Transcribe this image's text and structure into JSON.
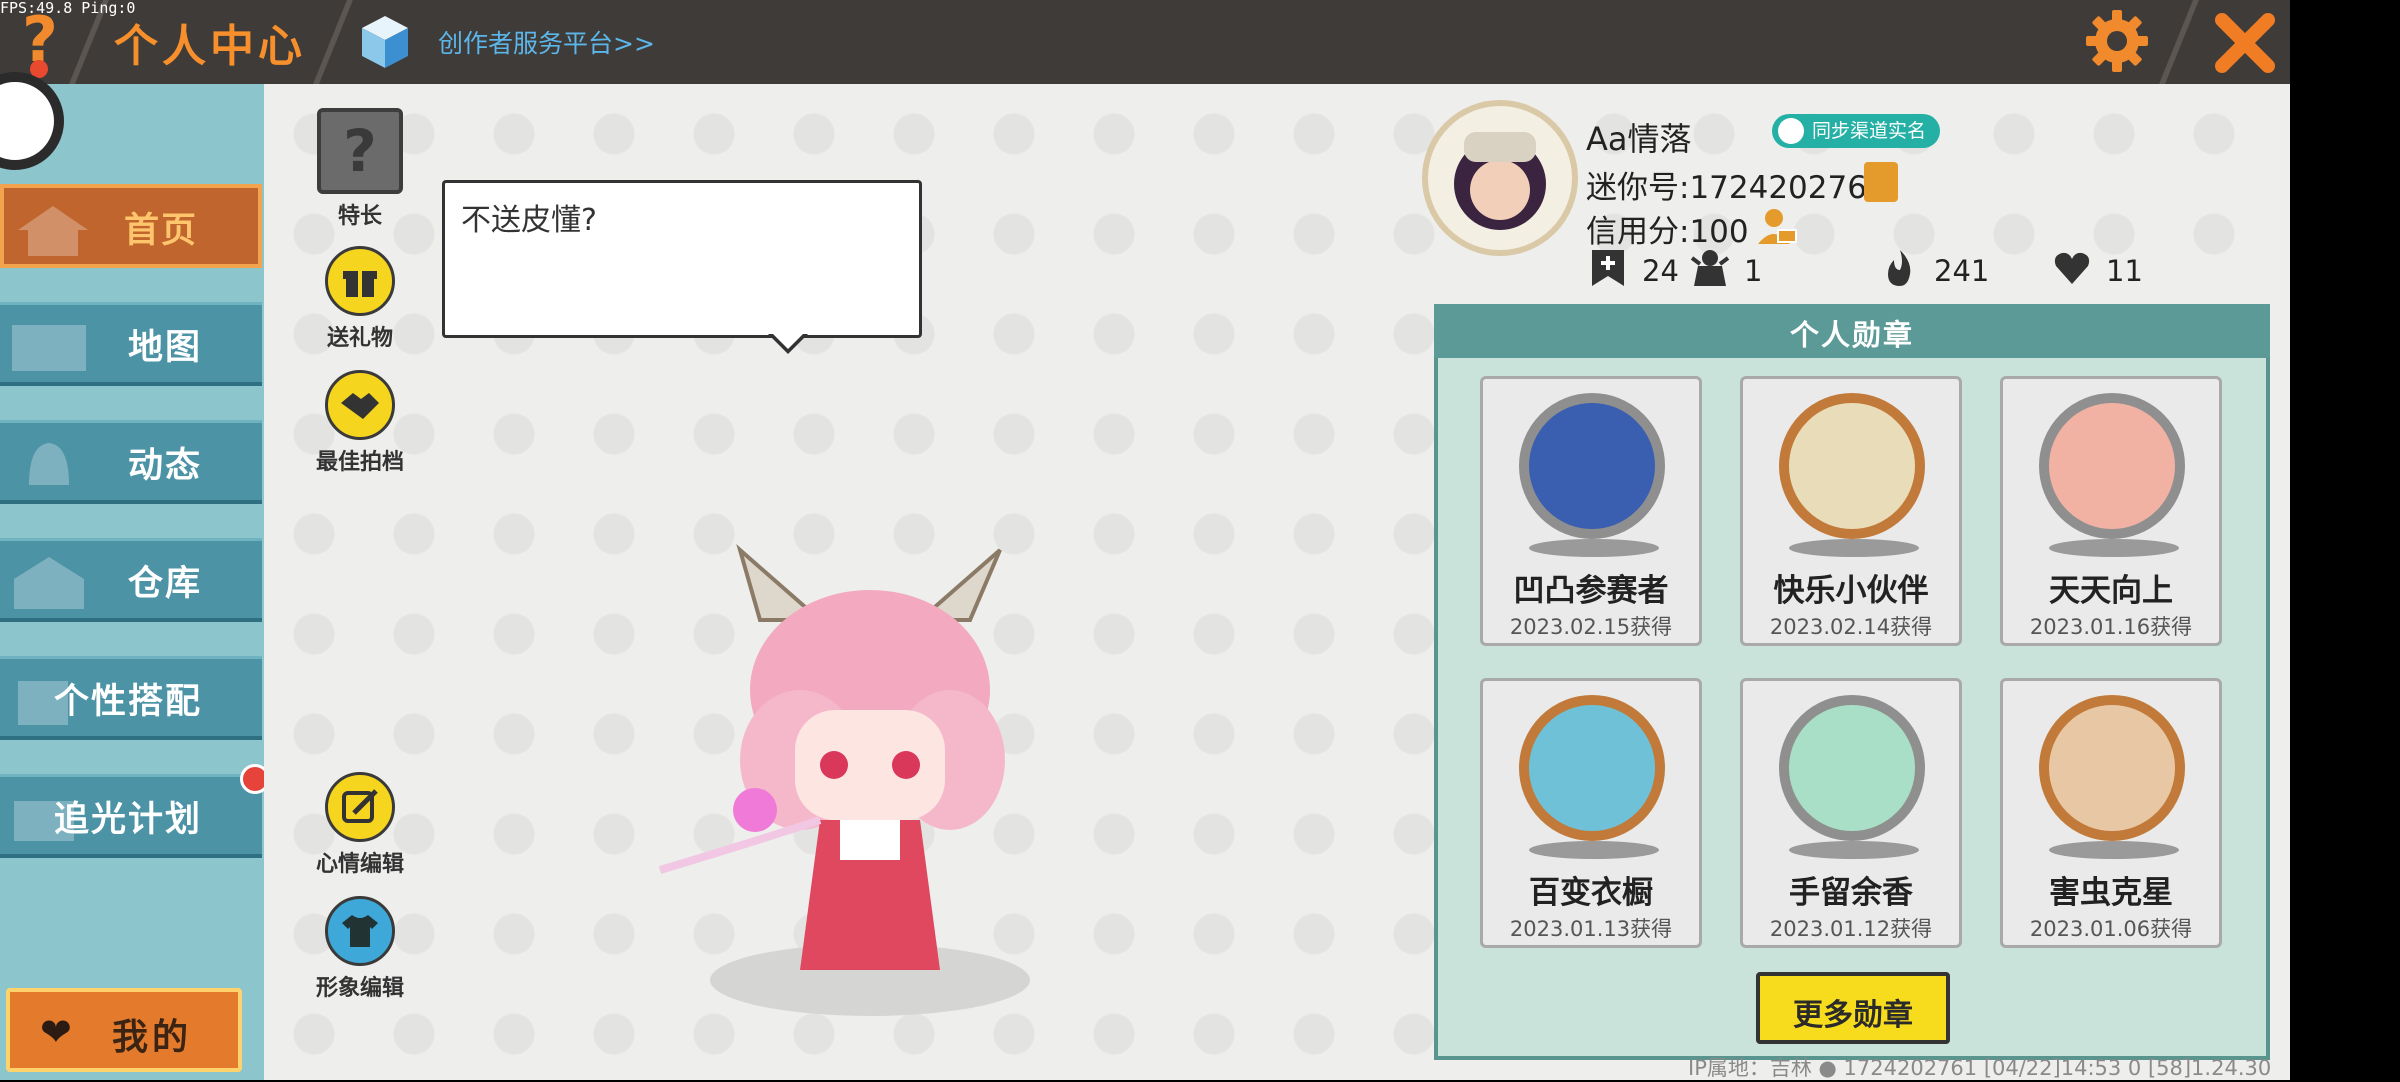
{
  "debug": {
    "fps_text": "FPS:49.8  Ping:0"
  },
  "header": {
    "title": "个人中心",
    "creator_link": "创作者服务平台>>",
    "icons": [
      "help-icon",
      "cube-icon",
      "gear-icon",
      "close-icon"
    ],
    "colors": {
      "bar": "#3f3b38",
      "title": "#f7902c",
      "link": "#5bb6ea",
      "accent": "#f08a2c"
    }
  },
  "sidebar": {
    "items": [
      {
        "label": "首页",
        "active": true
      },
      {
        "label": "地图",
        "active": false
      },
      {
        "label": "动态",
        "active": false
      },
      {
        "label": "仓库",
        "active": false
      },
      {
        "label": "个性搭配",
        "active": false
      },
      {
        "label": "追光计划",
        "active": false,
        "notification": true
      }
    ],
    "mine_button": "我的",
    "colors": {
      "bg": "#8dc5cd",
      "item": "#4c93a6",
      "active": "#c0652d"
    }
  },
  "actions": {
    "talent": "特长",
    "gift": "送礼物",
    "partner": "最佳拍档",
    "mood_edit": "心情编辑",
    "look_edit": "形象编辑"
  },
  "mood": {
    "text": "不送皮懂?"
  },
  "profile": {
    "nickname": "Aa情落",
    "sync_badge": "同步渠道实名",
    "mini_id": "迷你号:1724202761",
    "credit": "信用分:100",
    "stats": [
      {
        "icon": "bookmark-plus-icon",
        "value": "24"
      },
      {
        "icon": "fans-icon",
        "value": "1"
      },
      {
        "icon": "fire-icon",
        "value": "241"
      },
      {
        "icon": "heart-icon",
        "value": "11"
      }
    ]
  },
  "badges": {
    "title": "个人勋章",
    "items": [
      {
        "name": "凹凸参赛者",
        "date": "2023.02.15获得",
        "medal_color": "#3b5fb0",
        "rim": "#8f8f8f"
      },
      {
        "name": "快乐小伙伴",
        "date": "2023.02.14获得",
        "medal_color": "#e9dcb8",
        "rim": "#c27a3a"
      },
      {
        "name": "天天向上",
        "date": "2023.01.16获得",
        "medal_color": "#f1b2a4",
        "rim": "#8f8f8f"
      },
      {
        "name": "百变衣橱",
        "date": "2023.01.13获得",
        "medal_color": "#6fc1d8",
        "rim": "#c27a3a"
      },
      {
        "name": "手留余香",
        "date": "2023.01.12获得",
        "medal_color": "#a9dfc6",
        "rim": "#8f8f8f"
      },
      {
        "name": "害虫克星",
        "date": "2023.01.06获得",
        "medal_color": "#e7c7a4",
        "rim": "#c27a3a"
      }
    ],
    "more_button": "更多勋章"
  },
  "footer": {
    "info": "IP属地：吉林 ● 1724202761   [04/22]14:53 0  [58]1.24.30"
  }
}
